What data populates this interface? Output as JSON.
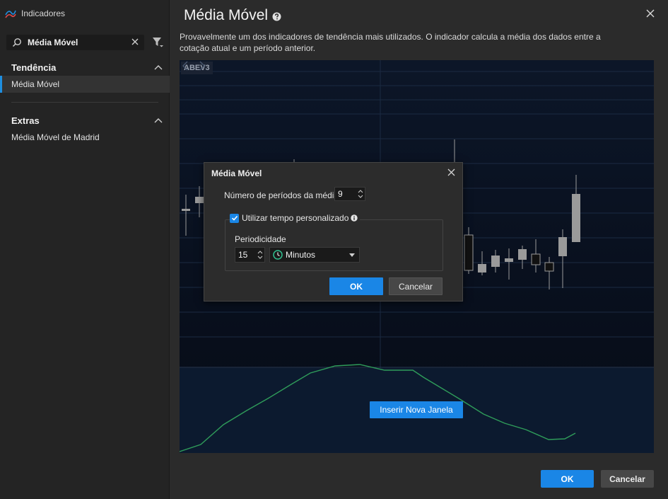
{
  "window": {
    "title": "Indicadores"
  },
  "search": {
    "value": "Média Móvel"
  },
  "sidebar": {
    "sections": [
      {
        "title": "Tendência",
        "items": [
          {
            "label": "Média Móvel",
            "active": true
          }
        ]
      },
      {
        "title": "Extras",
        "items": [
          {
            "label": "Média Móvel de Madrid",
            "active": false
          }
        ]
      }
    ]
  },
  "main": {
    "title": "Média Móvel",
    "description": "Provavelmente um dos indicadores de tendência mais utilizados. O indicador calcula a média dos dados entre a cotação atual e um período anterior.",
    "ticker": "ABEV3",
    "insert_window_label": "Inserir Nova Janela",
    "ok_label": "OK",
    "cancel_label": "Cancelar"
  },
  "dialog": {
    "title": "Média Móvel",
    "periods_label": "Número de períodos da média:",
    "periods_value": "9",
    "custom_time_label": "Utilizar tempo personalizado",
    "custom_time_checked": true,
    "periodicity_label": "Periodicidade",
    "periodicity_value": "15",
    "periodicity_unit": "Minutos",
    "ok_label": "OK",
    "cancel_label": "Cancelar"
  },
  "colors": {
    "accent": "#1a86e6",
    "chart_bg": "#0c1628",
    "indicator_line": "#2f9c5a",
    "candle_up": "#9a9a9a",
    "candle_down": "#111111"
  },
  "icons": {
    "app": "indicator-chart-icon",
    "search": "search-icon",
    "filter": "filter-icon",
    "help": "help-icon",
    "close": "close-icon",
    "info": "info-icon",
    "clock": "clock-icon"
  }
}
